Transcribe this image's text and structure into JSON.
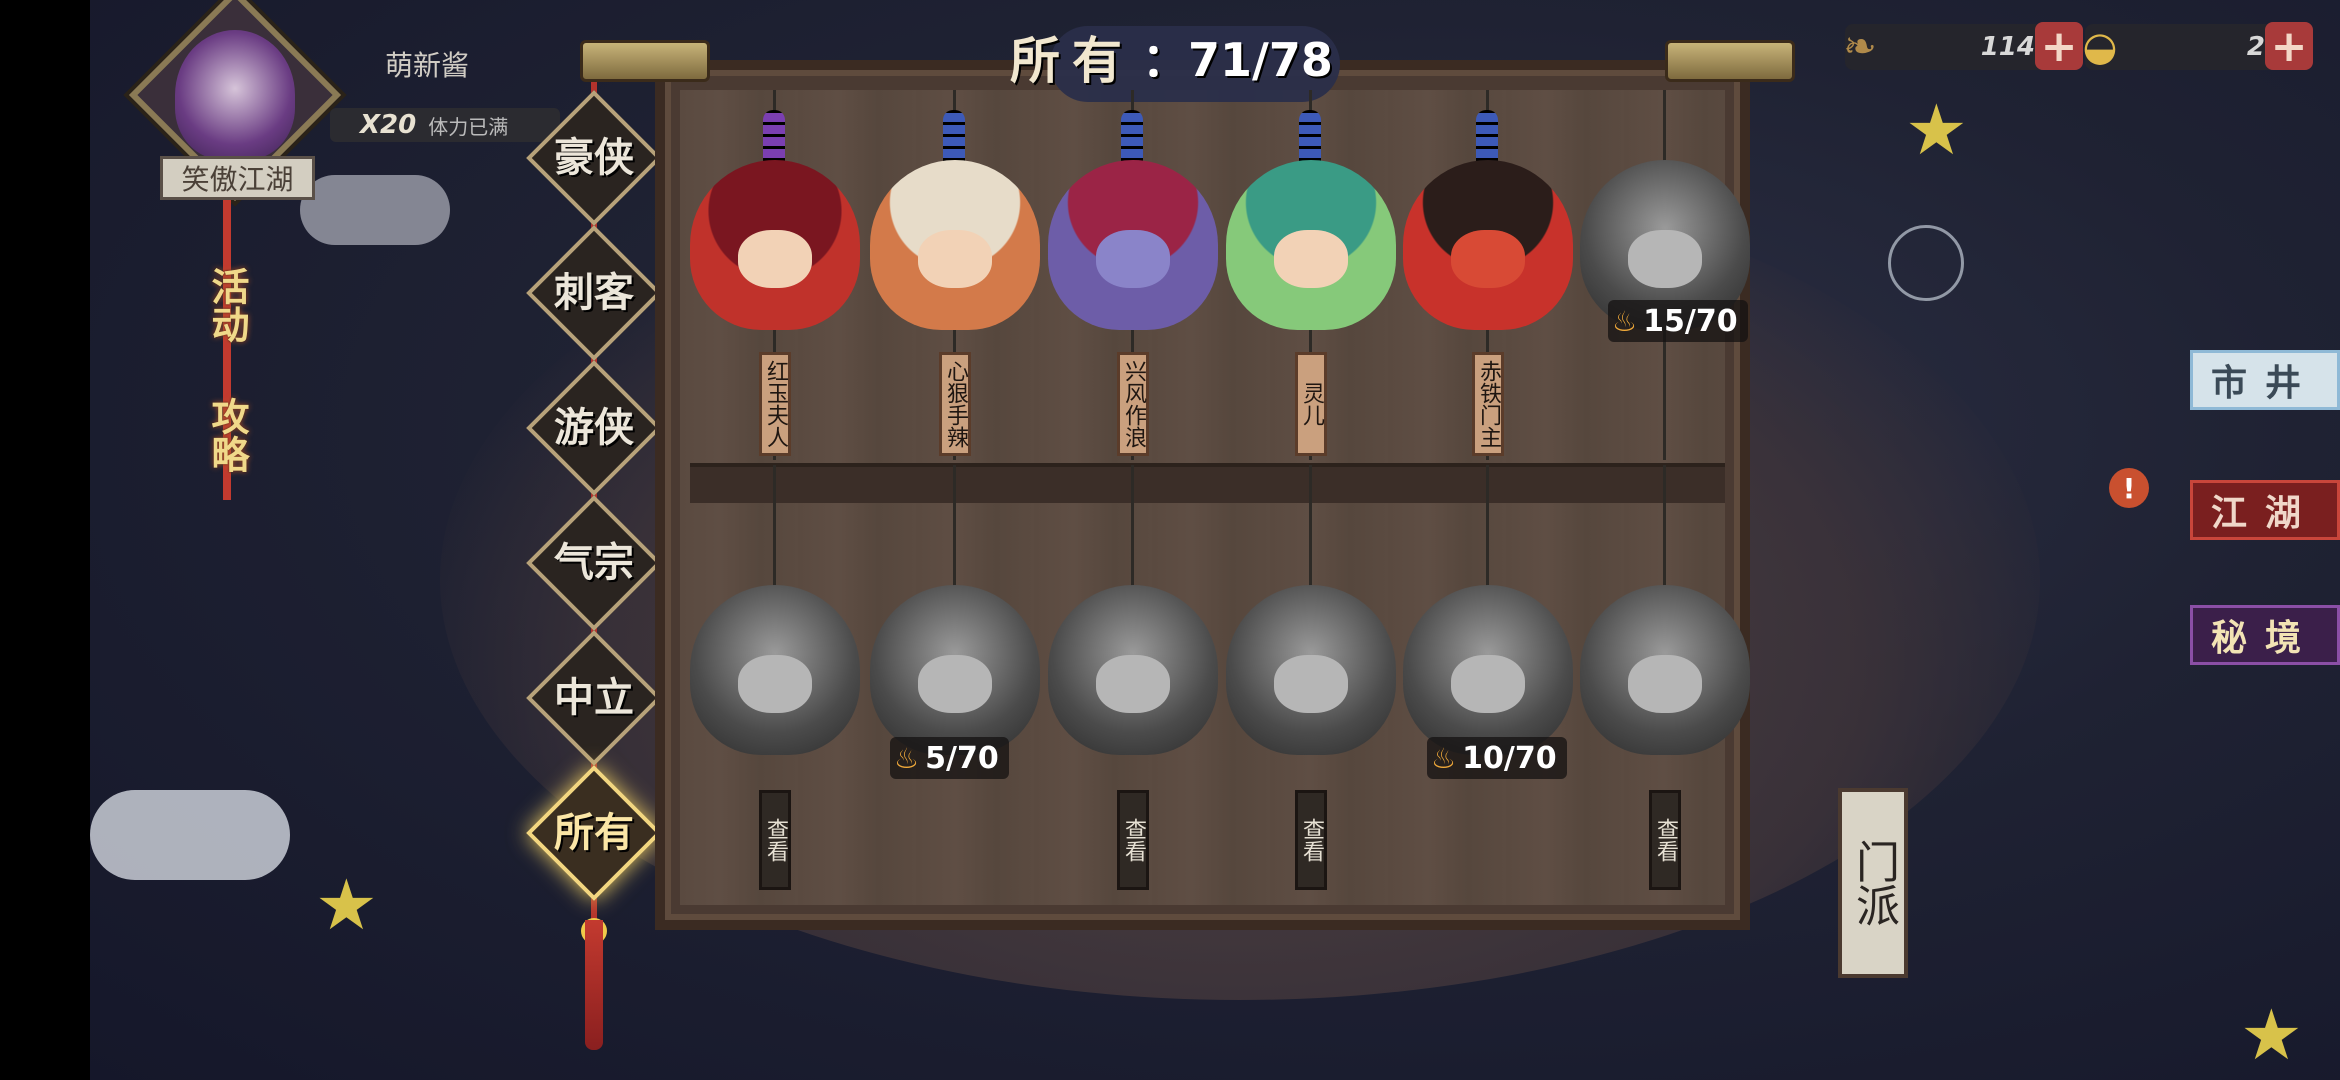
{
  "player": {
    "name": "萌新酱",
    "stamina_count": "X20",
    "stamina_status": "体力已满",
    "realm": "笑傲江湖"
  },
  "side_tags": [
    "活动",
    "攻略"
  ],
  "currency": [
    {
      "icon": "leaf-token-icon",
      "amount": "114"
    },
    {
      "icon": "gold-ingot-icon",
      "amount": "2"
    }
  ],
  "right_menu": [
    {
      "label": "市井",
      "color": "#8fb9d6"
    },
    {
      "label": "江湖",
      "color": "#c9463b"
    },
    {
      "label": "秘境",
      "color": "#8b4fa6"
    }
  ],
  "categories": [
    "豪侠",
    "刺客",
    "游侠",
    "气宗",
    "中立",
    "所有"
  ],
  "active_category": "所有",
  "collection": {
    "label": "所有",
    "count": "71/78"
  },
  "heroes_top": [
    {
      "name": "红玉夫人",
      "bead_color": "#7b3fb1",
      "body_color": "#c0322b",
      "hair_color": "#7a1620"
    },
    {
      "name": "心狠手辣",
      "bead_color": "#2f63c6",
      "body_color": "#d37a4a",
      "hair_color": "#e7dcc9"
    },
    {
      "name": "兴风作浪",
      "bead_color": "#2f63c6",
      "body_color": "#6d5da8",
      "hair_color": "#9b2446"
    },
    {
      "name": "灵儿",
      "bead_color": "#2f63c6",
      "body_color": "#86c97a",
      "hair_color": "#3a9b85"
    },
    {
      "name": "赤铁门主",
      "bead_color": "#2f63c6",
      "body_color": "#c8322b",
      "hair_color": "#2b1d1a"
    },
    {
      "name": "",
      "fragments": "15/70"
    }
  ],
  "heroes_bottom": [
    {
      "view_label": "查看"
    },
    {
      "fragments": "5/70"
    },
    {
      "view_label": "查看"
    },
    {
      "view_label": "查看"
    },
    {
      "fragments": "10/70"
    },
    {
      "view_label": "查看"
    }
  ],
  "bg_signs": [
    "门派"
  ]
}
